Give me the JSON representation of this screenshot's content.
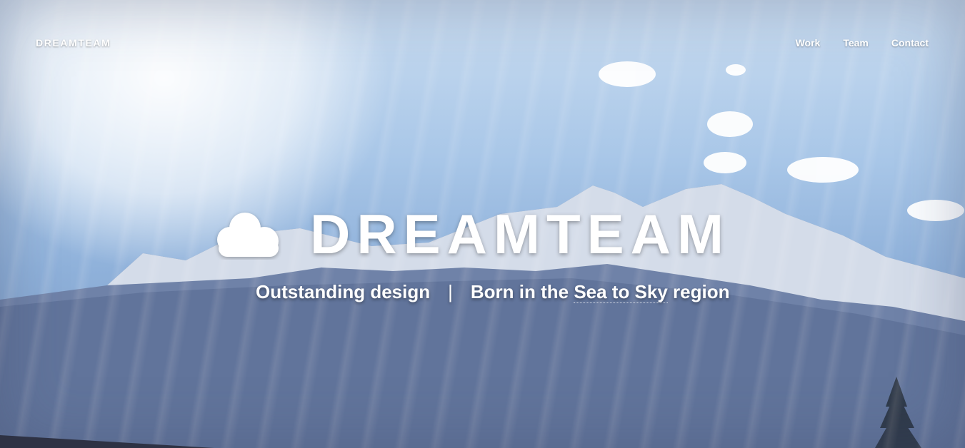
{
  "nav": {
    "logo": "DREAMTEAM",
    "links": [
      "Work",
      "Team",
      "Contact"
    ]
  },
  "hero": {
    "title": "DREAMTEAM",
    "icon": "cloud-icon",
    "tagline_left": "Outstanding design",
    "separator": "|",
    "tagline_right_prefix": "Born in the ",
    "tagline_right_link": "Sea to Sky",
    "tagline_right_suffix": " region"
  },
  "colors": {
    "text": "#ffffff",
    "sky": "#a9c7e8",
    "mountain": "#5e7197",
    "snow": "#e6ecf4",
    "footer_edge": "#2e3244"
  }
}
